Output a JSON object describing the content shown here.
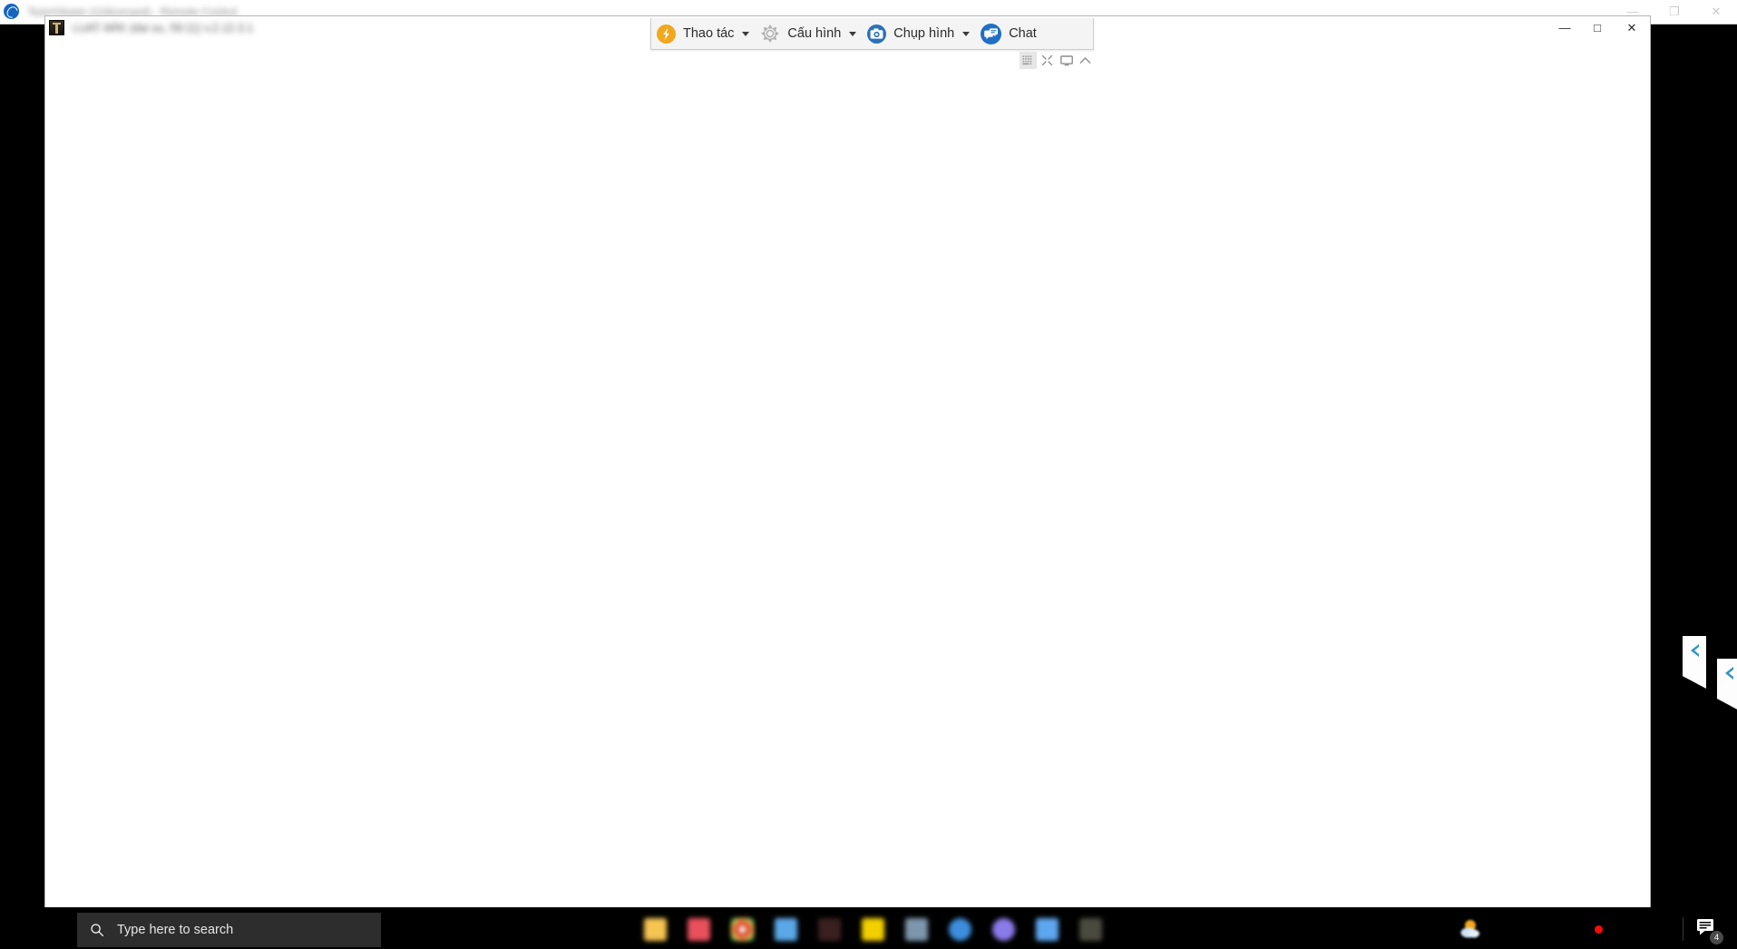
{
  "outer_window": {
    "app_icon": "compass-icon",
    "title": "TeamViewer (Unlicensed) - Remote Control",
    "controls": [
      {
        "name": "minimize",
        "glyph": "—"
      },
      {
        "name": "restore",
        "glyph": "❐"
      },
      {
        "name": "close",
        "glyph": "✕"
      }
    ]
  },
  "inner_window": {
    "app_icon": "remote-desktop-icon",
    "title": "LUAT ARK (dai su, 59:11) v.2.12.3.1",
    "controls": [
      {
        "name": "minimize",
        "glyph": "—"
      },
      {
        "name": "maximize",
        "glyph": "□"
      },
      {
        "name": "close",
        "glyph": "✕"
      }
    ]
  },
  "remote_toolbar": {
    "items": [
      {
        "id": "actions",
        "icon": "lightning-bolt-icon",
        "label": "Thao tác",
        "has_caret": true
      },
      {
        "id": "settings",
        "icon": "gear-icon",
        "label": "Cấu hình",
        "has_caret": true
      },
      {
        "id": "screenshot",
        "icon": "camera-icon",
        "label": "Chụp hình",
        "has_caret": true
      },
      {
        "id": "chat",
        "icon": "chat-bubble-icon",
        "label": "Chat",
        "has_caret": false
      }
    ],
    "subtray": [
      {
        "id": "keyboard",
        "icon": "keyboard-grid-icon"
      },
      {
        "id": "fullscreen",
        "icon": "expand-arrows-icon"
      },
      {
        "id": "monitor",
        "icon": "monitor-icon"
      },
      {
        "id": "collapse",
        "icon": "chevron-up-icon"
      }
    ]
  },
  "edge_tabs": [
    {
      "id": "panel-tab-1",
      "icon": "chevron-left-icon"
    },
    {
      "id": "panel-tab-2",
      "icon": "chevron-left-icon"
    }
  ],
  "taskbar": {
    "search": {
      "icon": "search-icon",
      "placeholder": "Type here to search",
      "value": ""
    },
    "pinned_apps": [
      {
        "id": "file-explorer",
        "name": "file-explorer-icon",
        "color": "#f5c451"
      },
      {
        "id": "pdf-reader",
        "name": "pdf-reader-icon",
        "color": "#e8505b"
      },
      {
        "id": "chrome",
        "name": "chrome-icon",
        "color": "#d9482e"
      },
      {
        "id": "blue-app",
        "name": "blue-app-icon",
        "color": "#5aa8e8"
      },
      {
        "id": "dark-red-app",
        "name": "dark-red-app-icon",
        "color": "#3a2020"
      },
      {
        "id": "yellow-app",
        "name": "yellow-app-icon",
        "color": "#f2d000"
      },
      {
        "id": "paint-app",
        "name": "paint-app-icon",
        "color": "#7d96ad"
      },
      {
        "id": "globe-app",
        "name": "globe-app-icon",
        "color": "#3d8ede"
      },
      {
        "id": "purple-app",
        "name": "purple-app-icon",
        "color": "#8a7bea"
      },
      {
        "id": "save-app",
        "name": "save-app-icon",
        "color": "#5ea6f0"
      },
      {
        "id": "terminal-app",
        "name": "terminal-app-icon",
        "color": "#4a4a3e"
      }
    ],
    "tray": {
      "weather": {
        "icon": "sun-cloud-icon"
      },
      "notification_dot": {
        "icon": "red-dot-icon",
        "color": "#f40c0c"
      },
      "action_center": {
        "icon": "action-center-icon",
        "badge": "4"
      }
    }
  }
}
